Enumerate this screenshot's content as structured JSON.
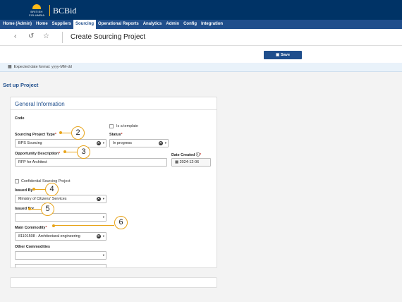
{
  "app": {
    "brand": "BCBid",
    "crest_text": "BRITISH COLUMBIA"
  },
  "nav": {
    "items": [
      {
        "label": "Home (Admin)",
        "active": false
      },
      {
        "label": "Home",
        "active": false
      },
      {
        "label": "Suppliers",
        "active": false
      },
      {
        "label": "Sourcing",
        "active": true
      },
      {
        "label": "Operational Reports",
        "active": false
      },
      {
        "label": "Analytics",
        "active": false
      },
      {
        "label": "Admin",
        "active": false
      },
      {
        "label": "Config",
        "active": false
      },
      {
        "label": "Integration",
        "active": false
      }
    ]
  },
  "header": {
    "title": "Create Sourcing Project",
    "icons": [
      "back-arrow-icon",
      "history-icon",
      "star-icon"
    ]
  },
  "toolbar": {
    "save_label": "Save",
    "save_icon": "save-icon"
  },
  "hint": {
    "text": "Expected date format: yyyy-MM-dd"
  },
  "section": {
    "title": "Set up Project"
  },
  "form": {
    "card_title": "General Information",
    "code_label": "Code",
    "template_label": "Is a template",
    "type_label": "Sourcing Project Type",
    "type_value": "BPS Sourcing",
    "status_label": "Status",
    "status_value": "In progress",
    "description_label": "Opportunity Description",
    "description_value": "RFP for Architect",
    "date_label": "Date Created",
    "date_value": "2024-12-06",
    "confidential_label": "Confidential Sourcing Project",
    "issued_by_label": "Issued By",
    "issued_by_value": "Ministry of Citizens' Services",
    "issued_for_label": "Issued For",
    "issued_for_value": "",
    "main_commodity_label": "Main Commodity",
    "main_commodity_value": "81101508 - Architectural engineering",
    "other_commodities_label": "Other Commodities",
    "other_commodities_value": "",
    "required_mark": "*"
  },
  "annotations": {
    "markers": [
      "2",
      "3",
      "4",
      "5",
      "6"
    ]
  },
  "colors": {
    "topbar": "#003366",
    "navbar": "#1f4e8c",
    "accent": "#fcba19",
    "marker": "#e8a317"
  }
}
